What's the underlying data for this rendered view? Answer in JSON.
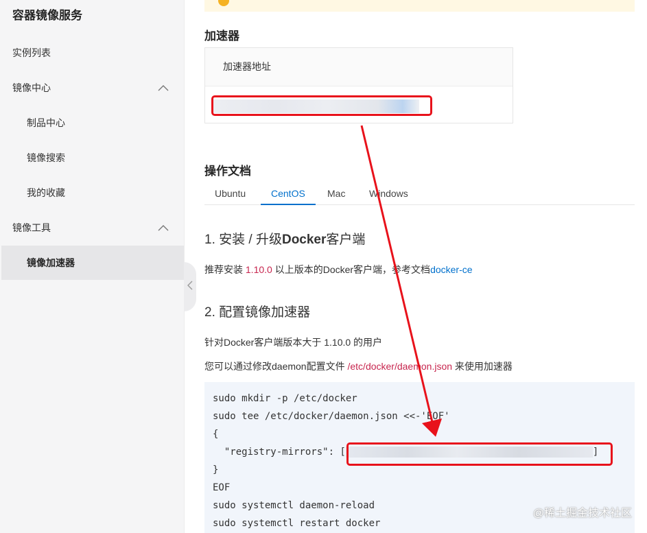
{
  "sidebar": {
    "title": "容器镜像服务",
    "items": [
      {
        "label": "实例列表"
      },
      {
        "label": "镜像中心"
      },
      {
        "label": "制品中心"
      },
      {
        "label": "镜像搜索"
      },
      {
        "label": "我的收藏"
      },
      {
        "label": "镜像工具"
      },
      {
        "label": "镜像加速器"
      }
    ]
  },
  "accelerator": {
    "heading": "加速器",
    "column_header": "加速器地址"
  },
  "docs": {
    "heading": "操作文档",
    "tabs": [
      "Ubuntu",
      "CentOS",
      "Mac",
      "Windows"
    ],
    "active_tab": "CentOS",
    "step1_num": "1. 安装 / 升级",
    "step1_bold": "Docker",
    "step1_rest": "客户端",
    "step1_text_a": "推荐安装 ",
    "step1_version": "1.10.0",
    "step1_text_b": " 以上版本的Docker客户端，参考文档",
    "step1_link": "docker-ce",
    "step2_title": "2. 配置镜像加速器",
    "step2_line1": "针对Docker客户端版本大于 1.10.0 的用户",
    "step2_line2_a": "您可以通过修改daemon配置文件 ",
    "step2_path": "/etc/docker/daemon.json",
    "step2_line2_b": " 来使用加速器"
  },
  "code": {
    "line1": "sudo mkdir -p /etc/docker",
    "line2": "sudo tee /etc/docker/daemon.json <<-'EOF'",
    "line3": "{",
    "line4_key": "  \"registry-mirrors\": [",
    "line4_end": "]",
    "line5": "}",
    "line6": "EOF",
    "line7": "sudo systemctl daemon-reload",
    "line8": "sudo systemctl restart docker"
  },
  "watermark": "@稀土掘金技术社区",
  "colors": {
    "accent": "#0070cc",
    "highlight_red": "#e8121b",
    "code_path_red": "#c7254e",
    "notice_yellow": "#fff8e3"
  }
}
